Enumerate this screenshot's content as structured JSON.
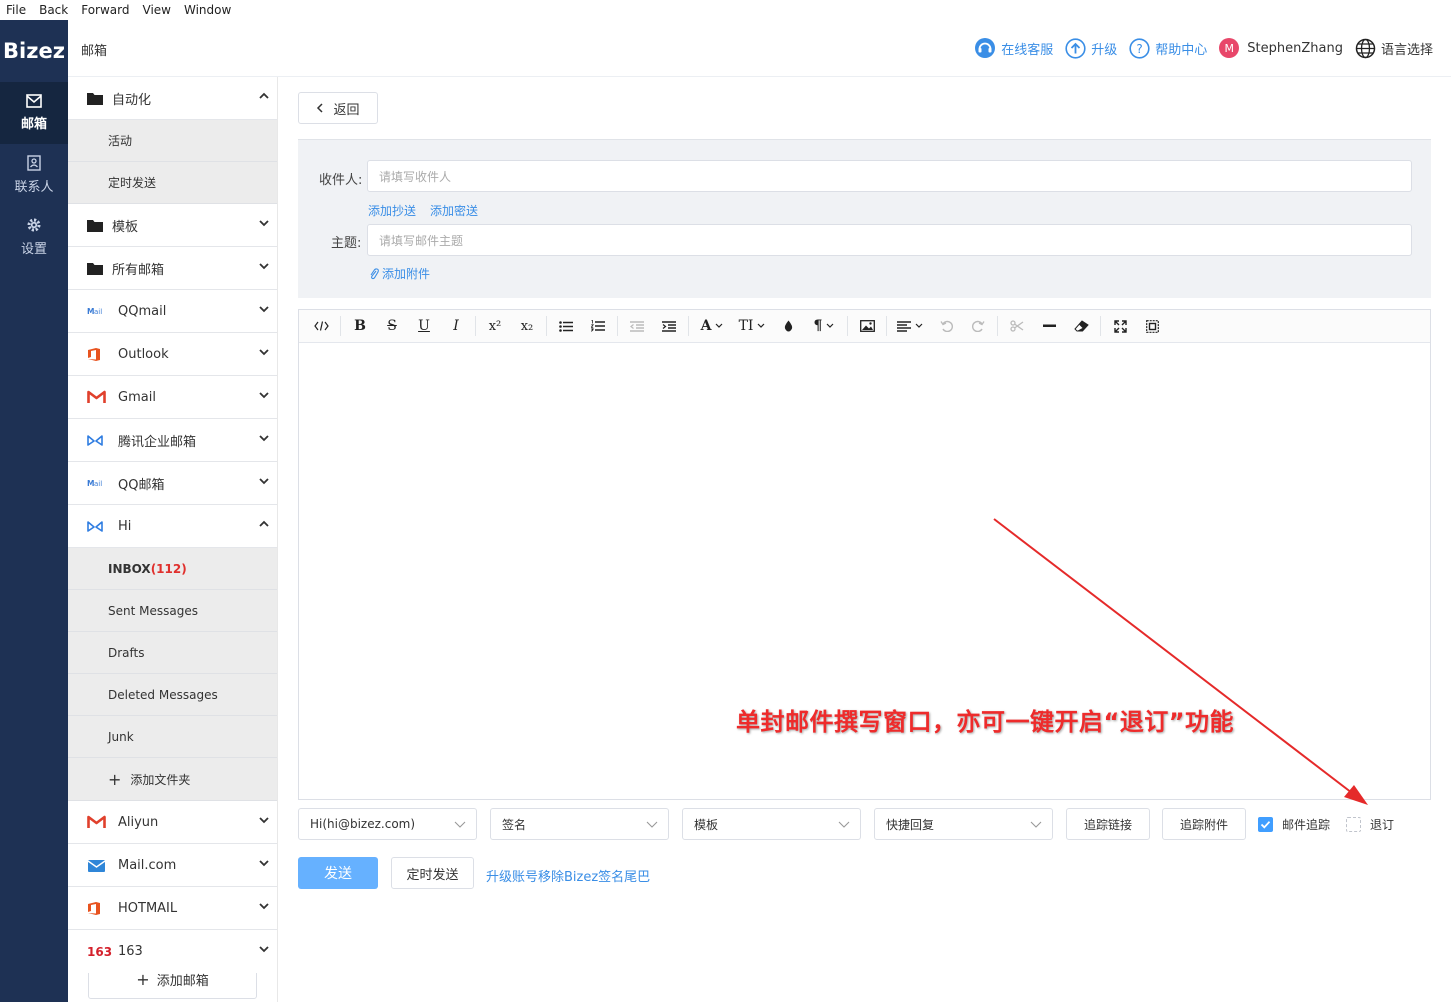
{
  "menubar": [
    "File",
    "Back",
    "Forward",
    "View",
    "Window"
  ],
  "logo": "Bizez",
  "leftnav": [
    {
      "label": "邮箱",
      "icon": "mail-icon",
      "active": true
    },
    {
      "label": "联系人",
      "icon": "contacts-icon",
      "active": false
    },
    {
      "label": "设置",
      "icon": "gear-icon",
      "active": false
    }
  ],
  "header": {
    "title": "邮箱",
    "support": "在线客服",
    "upgrade": "升级",
    "help": "帮助中心",
    "avatar_letter": "M",
    "user": "StephenZhang",
    "language": "语言选择"
  },
  "sidebar": {
    "automation": {
      "label": "自动化",
      "children": [
        "活动",
        "定时发送"
      ]
    },
    "templates": "模板",
    "all_mailboxes": "所有邮箱",
    "accounts_top": [
      {
        "label": "QQmail",
        "icon": "qqmail-icon"
      },
      {
        "label": "Outlook",
        "icon": "office-icon"
      },
      {
        "label": "Gmail",
        "icon": "gmail-icon"
      },
      {
        "label": "腾讯企业邮箱",
        "icon": "tencent-exmail-icon"
      },
      {
        "label": "QQ邮箱",
        "icon": "qqmail-icon"
      }
    ],
    "hi": {
      "label": "Hi",
      "inbox_label": "INBOX",
      "inbox_count": "(112)",
      "folders": [
        "Sent Messages",
        "Drafts",
        "Deleted Messages",
        "Junk"
      ],
      "add_folder": "添加文件夹"
    },
    "accounts_bottom": [
      {
        "label": "Aliyun",
        "icon": "aliyun-icon"
      },
      {
        "label": "Mail.com",
        "icon": "mailcom-icon"
      },
      {
        "label": "HOTMAIL",
        "icon": "office-icon"
      },
      {
        "label": "163",
        "icon": "netease-163-icon",
        "icon_text": "163"
      }
    ],
    "add_mailbox": "添加邮箱"
  },
  "compose": {
    "back": "返回",
    "to_label": "收件人:",
    "to_placeholder": "请填写收件人",
    "add_cc": "添加抄送",
    "add_bcc": "添加密送",
    "subject_label": "主题:",
    "subject_placeholder": "请填写邮件主题",
    "add_attachment": "添加附件",
    "annotation": "单封邮件撰写窗口，亦可一键开启“退订”功能",
    "from_account": "Hi(hi@bizez.com)",
    "signature": "签名",
    "template": "模板",
    "quick_reply": "快捷回复",
    "track_links": "追踪链接",
    "track_attachments": "追踪附件",
    "email_tracking": "邮件追踪",
    "email_tracking_checked": true,
    "unsubscribe": "退订",
    "unsubscribe_checked": false,
    "send": "发送",
    "schedule_send": "定时发送",
    "upgrade_link": "升级账号移除Bizez签名尾巴"
  },
  "toolbar": {
    "bold": "B",
    "strike": "S",
    "underline": "U",
    "italic": "I",
    "sup": "x²",
    "sub": "x₂",
    "font_color": "A",
    "font_size": "TI",
    "paragraph": "¶"
  },
  "colors": {
    "nav_bg": "#1e3154",
    "accent": "#3a8ee6",
    "send": "#66b1ff",
    "annotation": "#ee2b2b",
    "avatar": "#e8476a"
  }
}
